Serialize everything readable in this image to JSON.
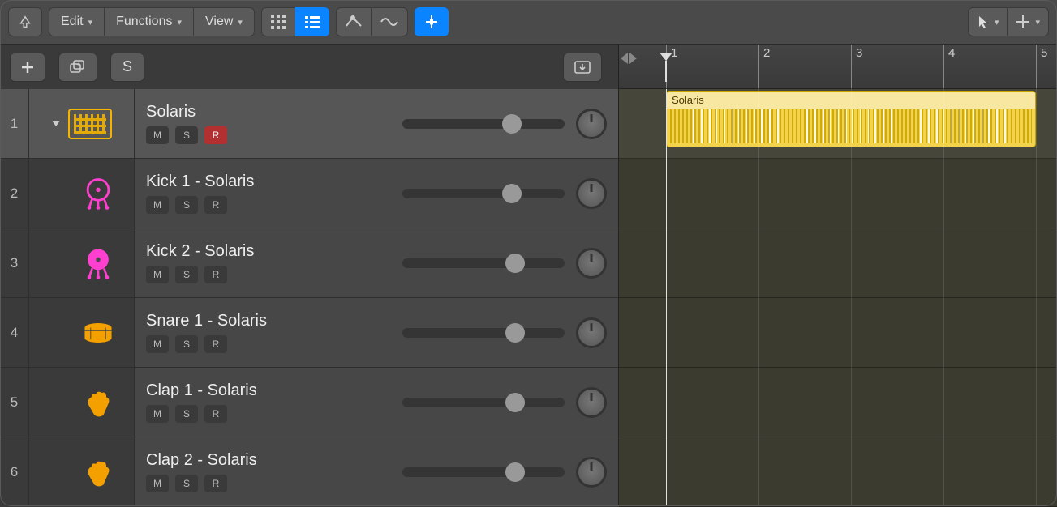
{
  "menus": {
    "edit": "Edit",
    "functions": "Functions",
    "view": "View"
  },
  "subbar": {
    "solo": "S"
  },
  "ruler": {
    "bars": [
      1,
      2,
      3,
      4,
      5
    ],
    "pxPerBar": 114,
    "startX": 58
  },
  "msr": {
    "m": "M",
    "s": "S",
    "r": "R"
  },
  "region": {
    "name": "Solaris",
    "startBar": 1,
    "endBar": 5
  },
  "tracks": [
    {
      "num": 1,
      "name": "Solaris",
      "type": "main",
      "icon": "pattern",
      "rec": true,
      "vol": 0.7,
      "color": "#f4b400"
    },
    {
      "num": 2,
      "name": "Kick 1 - Solaris",
      "type": "sub",
      "icon": "kick-open",
      "rec": false,
      "vol": 0.7,
      "color": "#ff3fcf"
    },
    {
      "num": 3,
      "name": "Kick 2 - Solaris",
      "type": "sub",
      "icon": "kick-solid",
      "rec": false,
      "vol": 0.72,
      "color": "#ff3fcf"
    },
    {
      "num": 4,
      "name": "Snare 1 - Solaris",
      "type": "sub",
      "icon": "snare",
      "rec": false,
      "vol": 0.72,
      "color": "#f4a000"
    },
    {
      "num": 5,
      "name": "Clap 1 - Solaris",
      "type": "sub",
      "icon": "clap",
      "rec": false,
      "vol": 0.72,
      "color": "#f4a000"
    },
    {
      "num": 6,
      "name": "Clap 2 - Solaris",
      "type": "sub",
      "icon": "clap",
      "rec": false,
      "vol": 0.72,
      "color": "#f4a000"
    }
  ]
}
